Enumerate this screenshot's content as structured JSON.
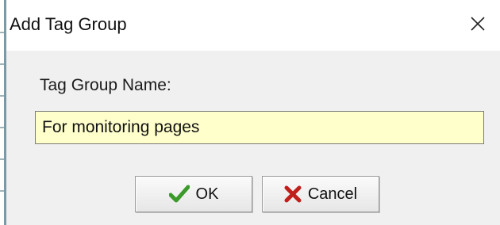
{
  "dialog": {
    "title": "Add Tag Group",
    "close_icon": "close-icon"
  },
  "form": {
    "field_label": "Tag Group Name:",
    "name_value": "For monitoring pages",
    "input_background": "#ffffcc"
  },
  "buttons": {
    "ok_label": "OK",
    "ok_icon": "checkmark-icon",
    "ok_icon_color": "#3a9a2a",
    "cancel_label": "Cancel",
    "cancel_icon": "x-icon",
    "cancel_icon_color": "#c0201c"
  }
}
